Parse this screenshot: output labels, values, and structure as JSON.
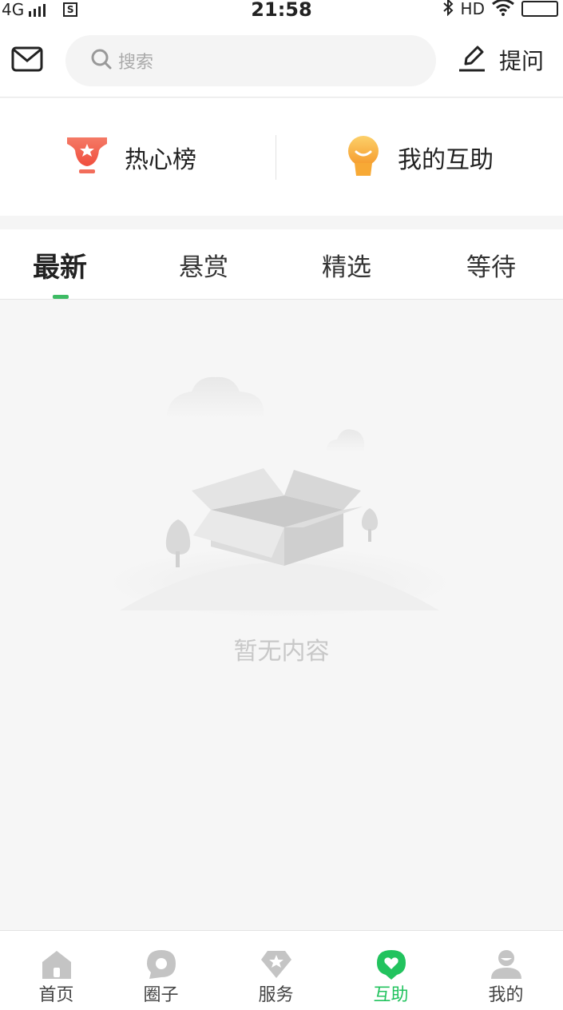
{
  "status_bar": {
    "network": "4G",
    "sim_badge": "S",
    "time": "21:58",
    "hd": "HD"
  },
  "header": {
    "search_placeholder": "搜索",
    "ask_label": "提问"
  },
  "quick_links": [
    {
      "label": "热心榜",
      "icon": "trophy-icon"
    },
    {
      "label": "我的互助",
      "icon": "smile-badge-icon"
    }
  ],
  "tabs": [
    {
      "label": "最新",
      "active": true
    },
    {
      "label": "悬赏",
      "active": false
    },
    {
      "label": "精选",
      "active": false
    },
    {
      "label": "等待",
      "active": false
    }
  ],
  "empty_state": {
    "message": "暂无内容"
  },
  "bottom_nav": [
    {
      "label": "首页",
      "icon": "home-icon",
      "active": false
    },
    {
      "label": "圈子",
      "icon": "circle-chat-icon",
      "active": false
    },
    {
      "label": "服务",
      "icon": "diamond-star-icon",
      "active": false
    },
    {
      "label": "互助",
      "icon": "heart-bubble-icon",
      "active": true
    },
    {
      "label": "我的",
      "icon": "user-icon",
      "active": false
    }
  ],
  "colors": {
    "accent": "#22c35e",
    "trophy": "#f26d5b",
    "smile": "#f7a935"
  }
}
